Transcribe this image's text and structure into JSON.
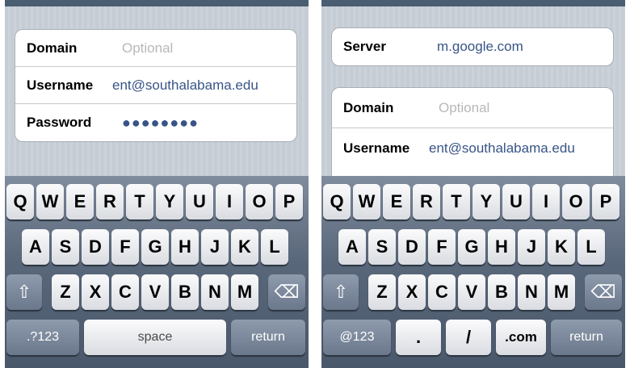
{
  "left": {
    "fields": [
      {
        "label": "Domain",
        "value": "Optional",
        "placeholder": true
      },
      {
        "label": "Username",
        "value": "ent@southalabama.edu",
        "placeholder": false
      },
      {
        "label": "Password",
        "value": "●●●●●●●●",
        "placeholder": false
      }
    ],
    "keyboard": {
      "row1": [
        "Q",
        "W",
        "E",
        "R",
        "T",
        "Y",
        "U",
        "I",
        "O",
        "P"
      ],
      "row2": [
        "A",
        "S",
        "D",
        "F",
        "G",
        "H",
        "J",
        "K",
        "L"
      ],
      "row3": [
        "Z",
        "X",
        "C",
        "V",
        "B",
        "N",
        "M"
      ],
      "shift_icon": "⇧",
      "delete_icon": "⌫",
      "numbers_label": ".?123",
      "space_label": "space",
      "return_label": "return"
    }
  },
  "right": {
    "server": {
      "label": "Server",
      "value": "m.google.com"
    },
    "fields": [
      {
        "label": "Domain",
        "value": "Optional",
        "placeholder": true
      },
      {
        "label": "Username",
        "value": "ent@southalabama.edu",
        "placeholder": false
      }
    ],
    "keyboard": {
      "row1": [
        "Q",
        "W",
        "E",
        "R",
        "T",
        "Y",
        "U",
        "I",
        "O",
        "P"
      ],
      "row2": [
        "A",
        "S",
        "D",
        "F",
        "G",
        "H",
        "J",
        "K",
        "L"
      ],
      "row3": [
        "Z",
        "X",
        "C",
        "V",
        "B",
        "N",
        "M"
      ],
      "shift_icon": "⇧",
      "delete_icon": "⌫",
      "numbers_label": "@123",
      "dot_label": ".",
      "slash_label": "/",
      "com_label": ".com",
      "return_label": "return"
    }
  }
}
